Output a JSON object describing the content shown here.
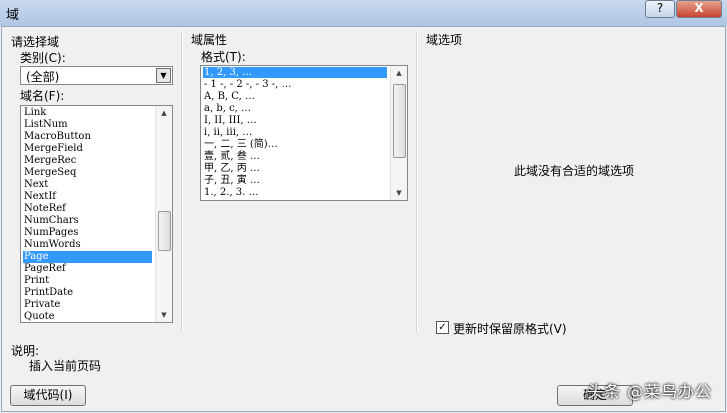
{
  "window": {
    "title": "域",
    "help_label": "?",
    "close_label": "X"
  },
  "left": {
    "section": "请选择域",
    "category_label": "类别(C):",
    "category_value": "(全部)",
    "fieldname_label": "域名(F):",
    "fieldnames": [
      "Link",
      "ListNum",
      "MacroButton",
      "MergeField",
      "MergeRec",
      "MergeSeq",
      "Next",
      "NextIf",
      "NoteRef",
      "NumChars",
      "NumPages",
      "NumWords",
      "Page",
      "PageRef",
      "Print",
      "PrintDate",
      "Private",
      "Quote"
    ],
    "selected_fieldname": "Page"
  },
  "middle": {
    "section": "域属性",
    "format_label": "格式(T):",
    "formats": [
      "1, 2, 3, …",
      "- 1 -, - 2 -, - 3 -, …",
      "A, B, C, …",
      "a, b, c, …",
      "I, II, III, …",
      "i, ii, iii, …",
      "一, 二, 三 (简)…",
      "壹, 贰, 叁 …",
      "甲, 乙, 丙 …",
      "子, 丑, 寅 …",
      "1., 2., 3. …"
    ],
    "selected_format": "1, 2, 3, …"
  },
  "right": {
    "section": "域选项",
    "no_options_text": "此域没有合适的域选项",
    "preserve_label": "更新时保留原格式(V)",
    "preserve_checked": true
  },
  "footer": {
    "description_label": "说明:",
    "description_text": "插入当前页码",
    "field_codes_button": "域代码(I)",
    "ok_button": "确定"
  },
  "watermark": "头条 @菜鸟办公"
}
